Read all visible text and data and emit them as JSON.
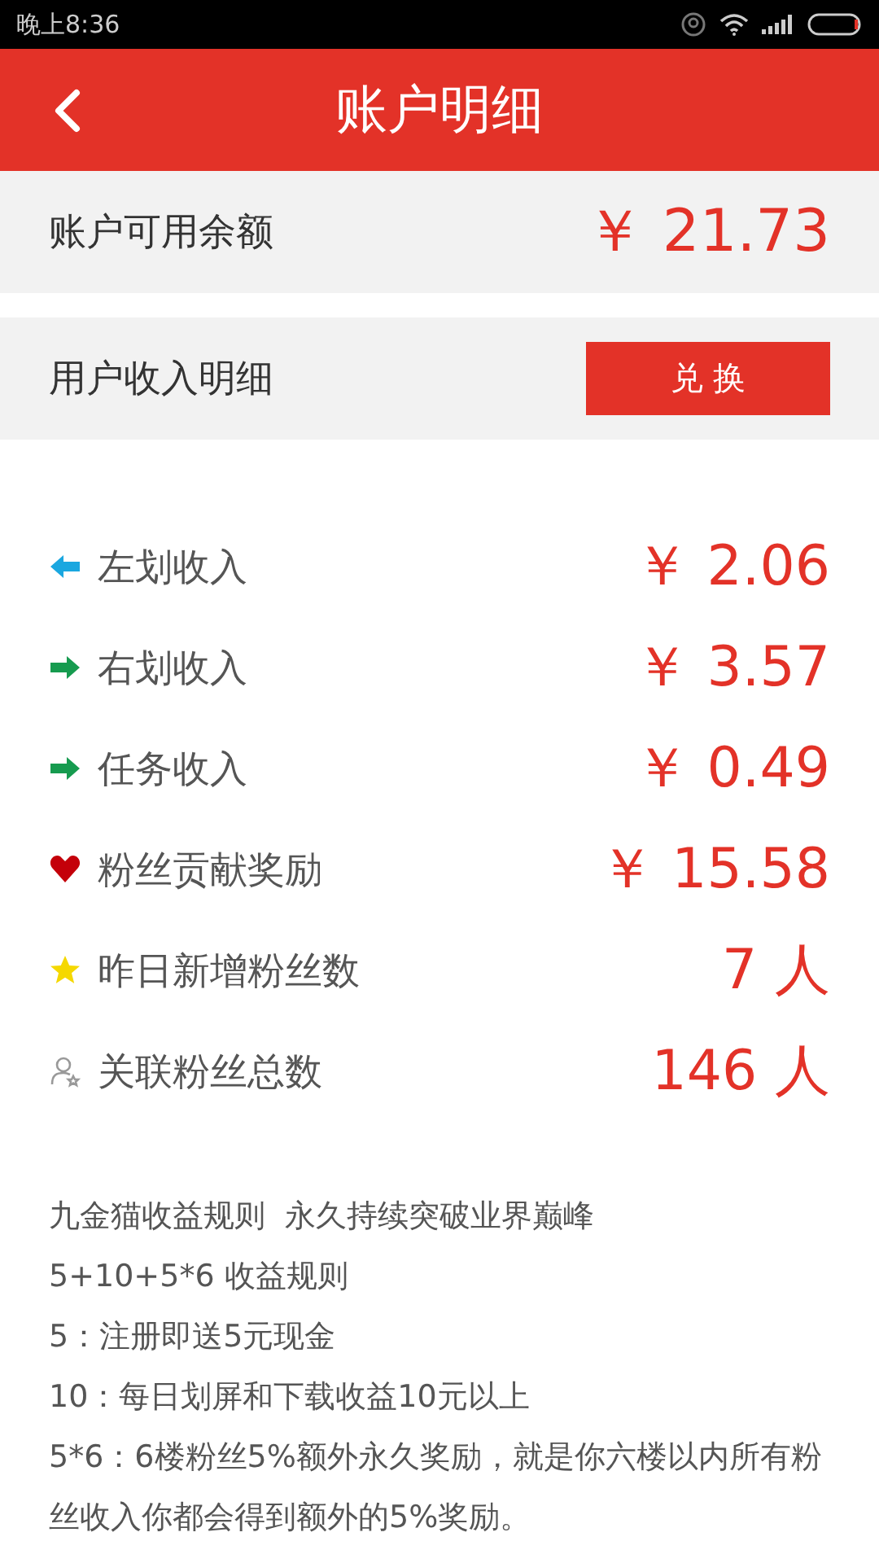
{
  "status_bar": {
    "time": "晚上8:36"
  },
  "header": {
    "title": "账户明细"
  },
  "balance": {
    "label": "账户可用余额",
    "amount": "￥ 21.73"
  },
  "income_header": {
    "label": "用户收入明细",
    "button": "兑 换"
  },
  "rows": [
    {
      "kind": "arrow-left",
      "label": "左划收入",
      "value": "￥ 2.06"
    },
    {
      "kind": "arrow-right",
      "label": "右划收入",
      "value": "￥ 3.57"
    },
    {
      "kind": "arrow-right",
      "label": "任务收入",
      "value": "￥ 0.49"
    },
    {
      "kind": "heart",
      "label": "粉丝贡献奖励",
      "value": "￥ 15.58"
    },
    {
      "kind": "star",
      "label": "昨日新增粉丝数",
      "value": "7 人"
    },
    {
      "kind": "person",
      "label": "关联粉丝总数",
      "value": "146 人"
    }
  ],
  "notes": [
    "九金猫收益规则  永久持续突破业界巅峰",
    "5+10+5*6 收益规则",
    "5：注册即送5元现金",
    "10：每日划屏和下载收益10元以上",
    "5*6：6楼粉丝5%额外永久奖励，就是你六楼以内所有粉丝收入你都会得到额外的5%奖励。"
  ]
}
